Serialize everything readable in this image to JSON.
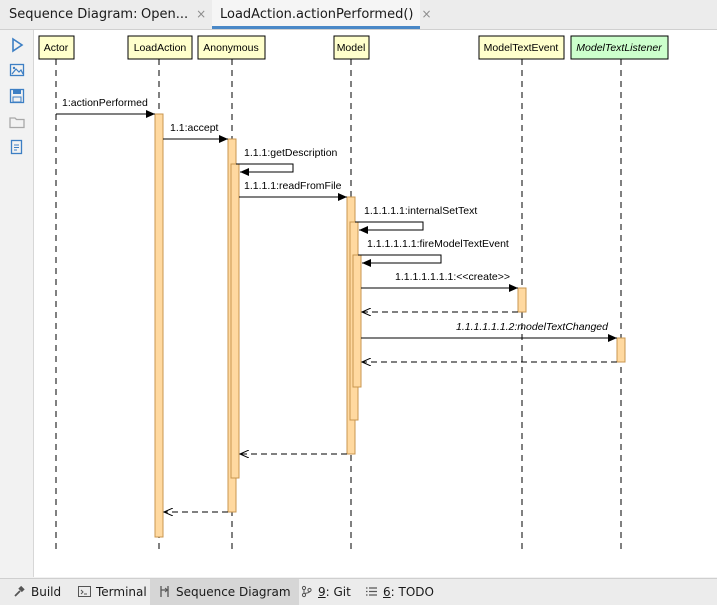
{
  "header": {
    "title": "Sequence Diagram:",
    "tabs": [
      {
        "label": "Open..."
      },
      {
        "label": "LoadAction.actionPerformed()"
      }
    ],
    "close_glyph": "×"
  },
  "toolbar": {
    "icons": [
      "play-icon",
      "image-icon",
      "save-icon",
      "folder-icon",
      "export-icon"
    ]
  },
  "diagram": {
    "participants": [
      {
        "label": "Actor"
      },
      {
        "label": "LoadAction"
      },
      {
        "label": "Anonymous"
      },
      {
        "label": "Model"
      },
      {
        "label": "ModelTextEvent"
      },
      {
        "label": "ModelTextListener"
      }
    ],
    "messages": [
      {
        "label": "1:actionPerformed"
      },
      {
        "label": "1.1:accept"
      },
      {
        "label": "1.1.1:getDescription"
      },
      {
        "label": "1.1.1.1:readFromFile"
      },
      {
        "label": "1.1.1.1.1:internalSetText"
      },
      {
        "label": "1.1.1.1.1.1:fireModelTextEvent"
      },
      {
        "label": "1.1.1.1.1.1.1:<<create>>"
      },
      {
        "label": "1.1.1.1.1.1.2:modelTextChanged"
      }
    ],
    "colors": {
      "participant_fill": "#ffffcc",
      "interface_fill": "#ccffcc",
      "activation_fill": "#ffd9a0",
      "activation_stroke": "#c8964f"
    }
  },
  "bottombar": {
    "items": [
      {
        "label": "Build"
      },
      {
        "label": "Terminal"
      },
      {
        "label": "Sequence Diagram"
      },
      {
        "num": "9",
        "label": ": Git"
      },
      {
        "num": "6",
        "label": ": TODO"
      }
    ]
  }
}
